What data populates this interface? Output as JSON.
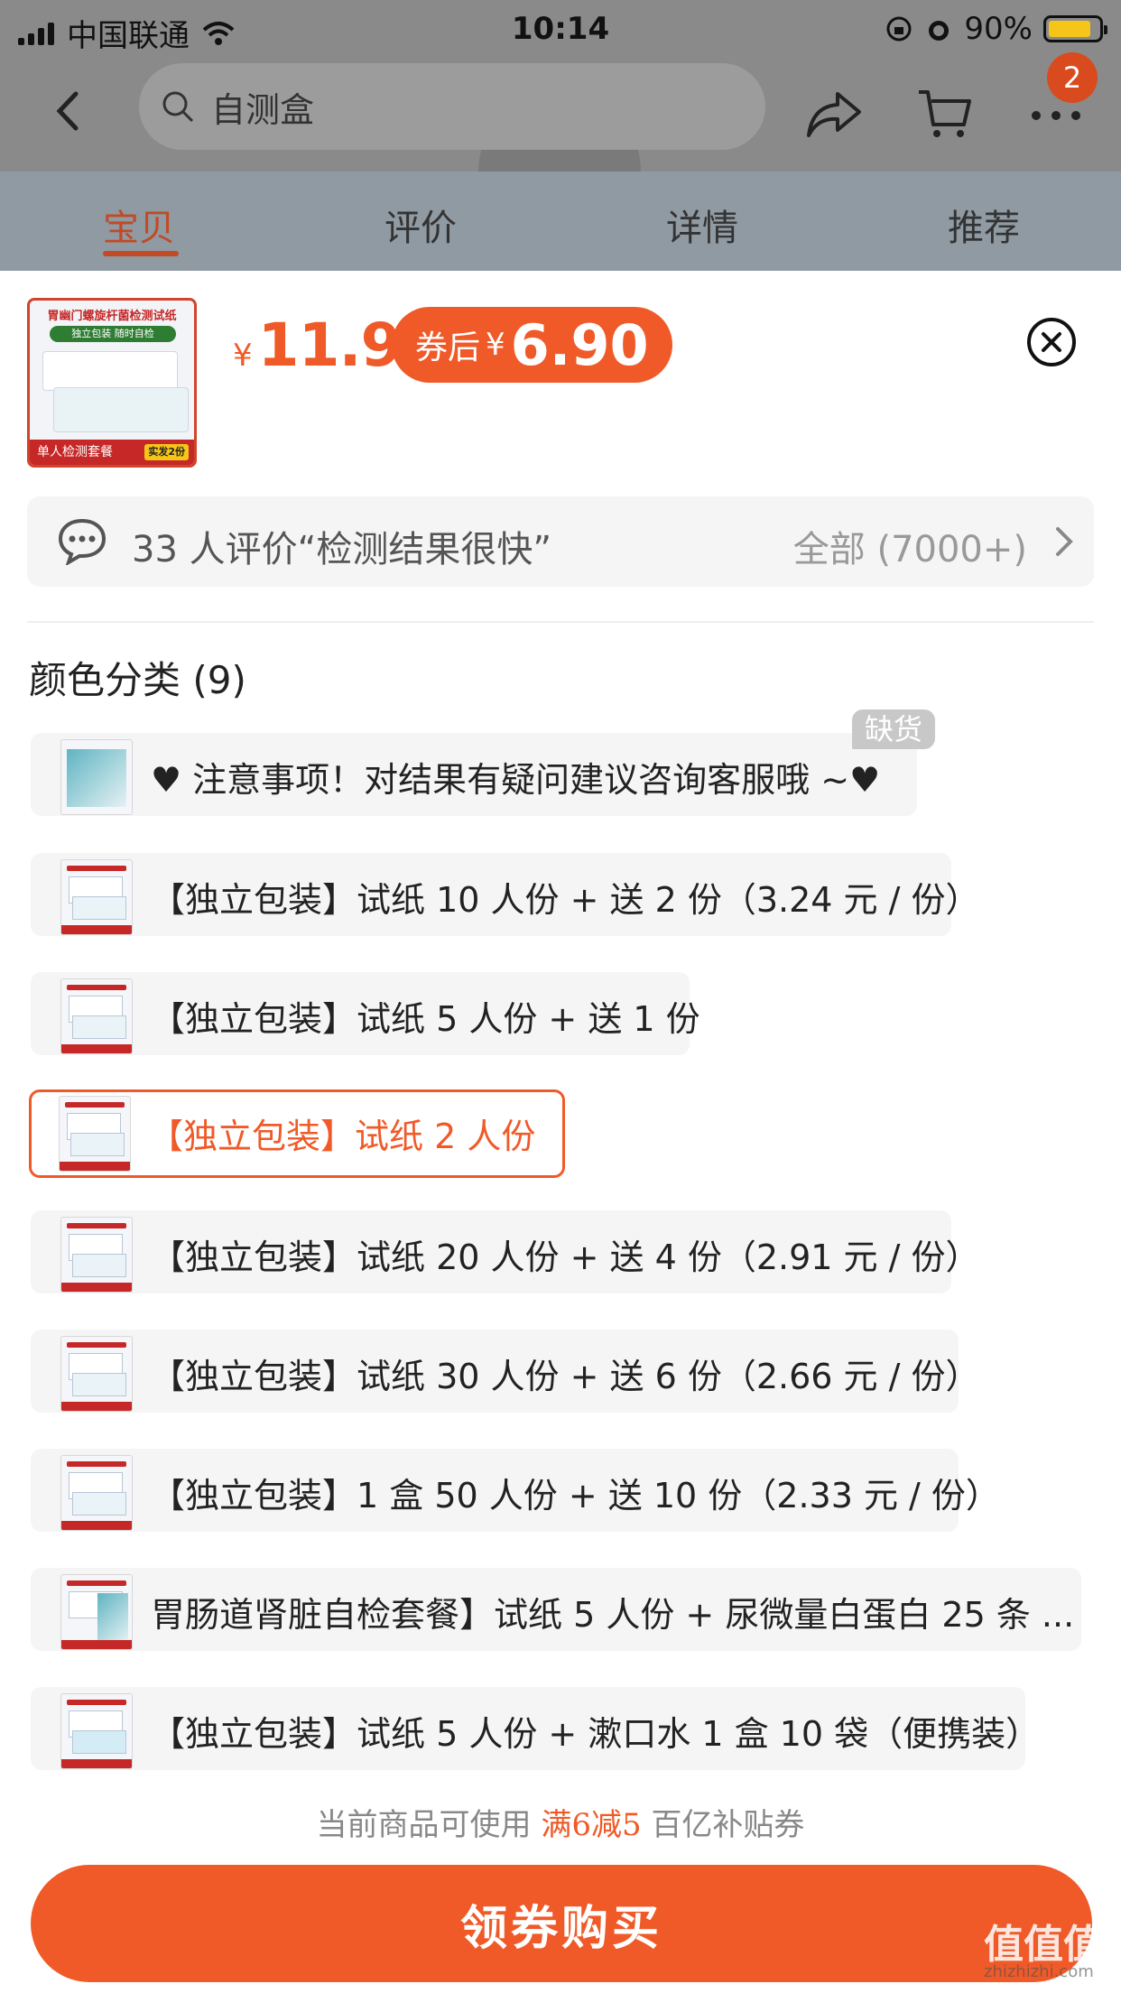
{
  "status_bar": {
    "carrier": "中国联通",
    "time": "10:14",
    "battery": "90%"
  },
  "nav": {
    "search_text": "自测盒",
    "cart_badge": "2"
  },
  "tabs": [
    {
      "label": "宝贝",
      "active": true
    },
    {
      "label": "评价",
      "active": false
    },
    {
      "label": "详情",
      "active": false
    },
    {
      "label": "推荐",
      "active": false
    }
  ],
  "product": {
    "thumb_title": "胃幽门螺旋杆菌检测试纸",
    "thumb_pill": "独立包装 随时自检",
    "thumb_footer": "单人检测套餐",
    "thumb_footer_tag": "实发2份",
    "currency": "¥",
    "price": "11.9",
    "coupon_label": "券后",
    "coupon_currency": "¥",
    "coupon_price": "6.90"
  },
  "review": {
    "summary": "33 人评价“检测结果很快”",
    "all_label": "全部 (7000+)"
  },
  "section": {
    "title": "颜色分类 (9)"
  },
  "options": [
    {
      "label": "♥ 注意事项！对结果有疑问建议咨询客服哦 ~♥",
      "out_of_stock": true
    },
    {
      "label": "【独立包装】试纸 10 人份 + 送 2 份（3.24 元 / 份）"
    },
    {
      "label": "【独立包装】试纸 5 人份 + 送 1 份"
    },
    {
      "label": "【独立包装】试纸 2 人份",
      "selected": true
    },
    {
      "label": "【独立包装】试纸 20 人份 + 送 4 份（2.91 元 / 份）"
    },
    {
      "label": "【独立包装】试纸 30 人份 + 送 6 份（2.66 元 / 份）"
    },
    {
      "label": "【独立包装】1 盒 50 人份 + 送 10 份（2.33 元 / 份）"
    },
    {
      "label": "胃肠道肾脏自检套餐】试纸 5 人份 + 尿微量白蛋白 25 条 ..."
    },
    {
      "label": "【独立包装】试纸 5 人份 + 漱口水 1 盒 10 袋（便携装）"
    }
  ],
  "stock_tag": "缺货",
  "coupon_note": {
    "prefix": "当前商品可使用",
    "highlight": "满6减5",
    "suffix": "百亿补贴券"
  },
  "buy_button": "领券购买",
  "watermark": {
    "main": "值值值",
    "sub": "zhizhizhi.com"
  },
  "colors": {
    "accent": "#f05a28",
    "overlay": "#8a8a8a"
  }
}
